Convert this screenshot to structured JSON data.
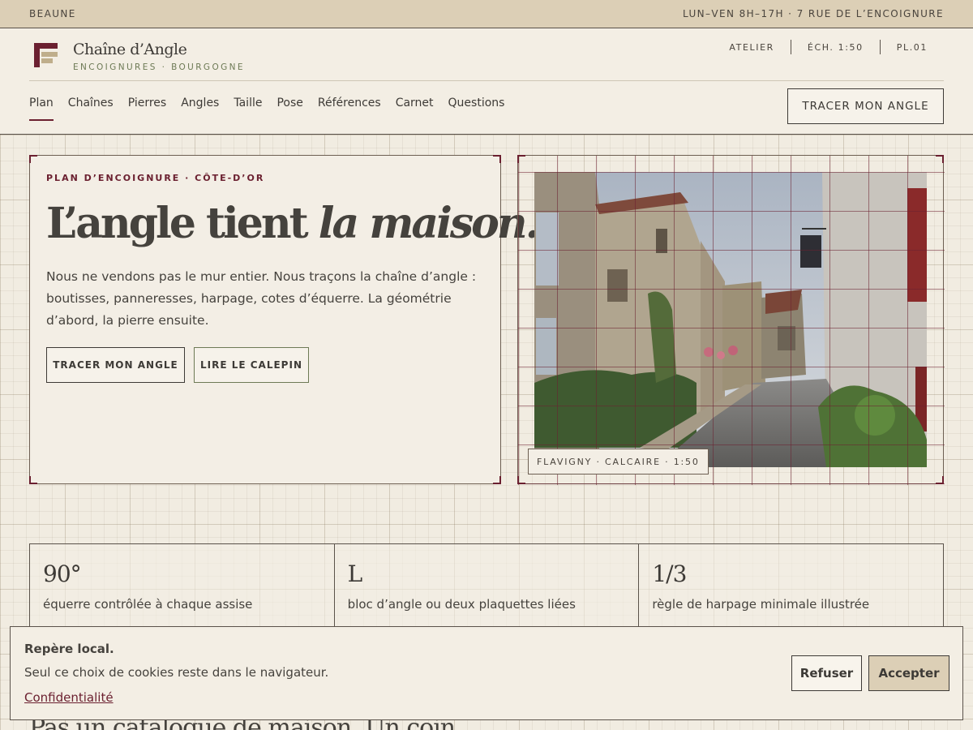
{
  "topbar": {
    "city": "BEAUNE",
    "hours": "LUN–VEN 8H–17H · 7 RUE DE L’ENCOIGNURE"
  },
  "brand": {
    "name": "Chaîne d’Angle",
    "tagline": "ENCOIGNURES · BOURGOGNE"
  },
  "meta": [
    "ATELIER",
    "ÉCH. 1:50",
    "PL.01"
  ],
  "nav": {
    "items": [
      "Plan",
      "Chaînes",
      "Pierres",
      "Angles",
      "Taille",
      "Pose",
      "Références",
      "Carnet",
      "Questions"
    ],
    "active": "Plan",
    "cta": "TRACER MON ANGLE"
  },
  "hero": {
    "eyebrow": "PLAN D’ENCOIGNURE · CÔTE-D’OR",
    "title_plain": "L’angle tient ",
    "title_italic": "la maison.",
    "body": "Nous ne vendons pas le mur entier. Nous traçons la chaîne d’angle : boutisses, panneresses, harpage, cotes d’équerre. La géométrie d’abord, la pierre ensuite.",
    "btn_primary": "TRACER MON ANGLE",
    "btn_secondary": "LIRE LE CALEPIN",
    "photo_caption": "FLAVIGNY · CALCAIRE · 1:50"
  },
  "stats": [
    {
      "value": "90°",
      "label": "équerre contrôlée à chaque assise"
    },
    {
      "value": "L",
      "label": "bloc d’angle ou deux plaquettes liées"
    },
    {
      "value": "1/3",
      "label": "règle de harpage minimale illustrée"
    }
  ],
  "behind_section_title": "Pas un catalogue de maison. Un coin.",
  "cookie": {
    "title": "Repère local.",
    "text": "Seul ce choix de cookies reste dans le navigateur.",
    "link": "Confidentialité",
    "refuse": "Refuser",
    "accept": "Accepter"
  },
  "colors": {
    "accent": "#6b2030",
    "sage": "#6d7a55",
    "sand": "#dccfb6",
    "paper": "#f1ece1",
    "ink": "#3d3a36"
  }
}
